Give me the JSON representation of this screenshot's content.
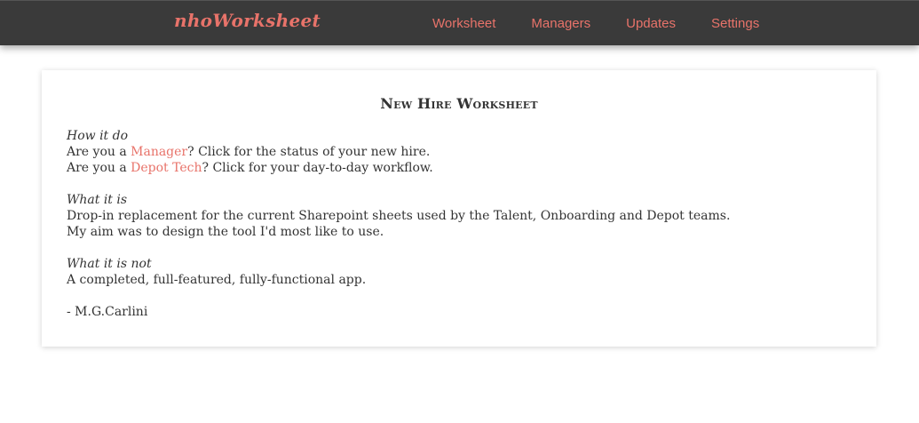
{
  "header": {
    "brand": "nhoWorksheet",
    "nav": [
      "Worksheet",
      "Managers",
      "Updates",
      "Settings"
    ]
  },
  "card": {
    "title": "New Hire Worksheet",
    "how": {
      "heading": "How it do",
      "line1_prefix": "Are you a ",
      "line1_link": "Manager",
      "line1_suffix": "? Click for the status of your new hire.",
      "line2_prefix": "Are you a ",
      "line2_link": "Depot Tech",
      "line2_suffix": "? Click for your day-to-day workflow."
    },
    "what": {
      "heading": "What it is",
      "line1": "Drop-in replacement for the current Sharepoint sheets used by the Talent, Onboarding and Depot teams.",
      "line2": "My aim was to design the tool I'd most like to use."
    },
    "whatnot": {
      "heading": "What it is not",
      "line1": "A completed, full-featured, fully-functional app."
    },
    "signature": "- M.G.Carlini"
  },
  "colors": {
    "accent": "#e8736a",
    "navbar": "#3a3a3a"
  }
}
